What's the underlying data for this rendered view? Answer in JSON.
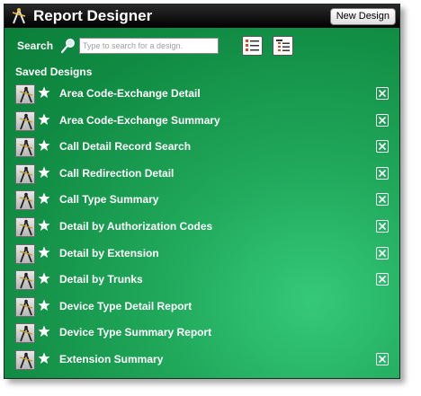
{
  "window": {
    "title": "Report Designer",
    "new_button_label": "New Design",
    "app_icon": "compass-icon"
  },
  "search": {
    "label": "Search",
    "placeholder": "Type to search for a design.",
    "value": "",
    "icon": "search-icon"
  },
  "view_buttons": [
    {
      "name": "list-view-icon"
    },
    {
      "name": "detail-view-icon"
    }
  ],
  "saved": {
    "title": "Saved Designs",
    "items": [
      {
        "label": "Area Code-Exchange Detail",
        "deletable": true
      },
      {
        "label": "Area Code-Exchange Summary",
        "deletable": true
      },
      {
        "label": "Call Detail Record Search",
        "deletable": true
      },
      {
        "label": "Call Redirection Detail",
        "deletable": true
      },
      {
        "label": "Call Type Summary",
        "deletable": true
      },
      {
        "label": "Detail by Authorization Codes",
        "deletable": true
      },
      {
        "label": "Detail by Extension",
        "deletable": true
      },
      {
        "label": "Detail by Trunks",
        "deletable": true
      },
      {
        "label": "Device Type Detail Report",
        "deletable": false
      },
      {
        "label": "Device Type Summary Report",
        "deletable": false
      },
      {
        "label": "Extension Summary",
        "deletable": true
      }
    ]
  },
  "colors": {
    "titlebar": "#000000",
    "panel_green": "#1fa85a",
    "text": "#ffffff"
  }
}
